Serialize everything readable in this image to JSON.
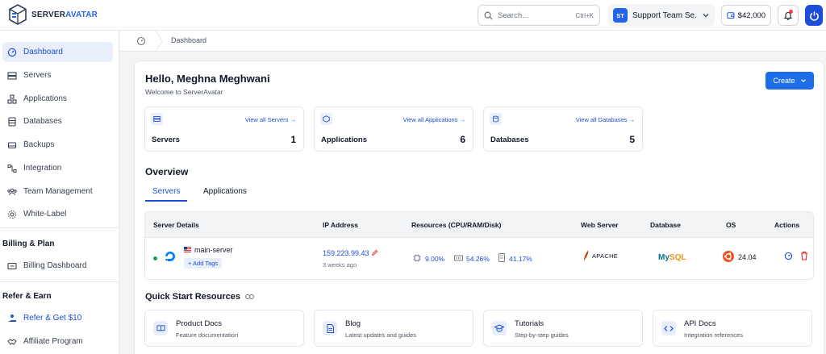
{
  "brand": {
    "name_dark": "SERVER",
    "name_accent": "AVATAR"
  },
  "topbar": {
    "search_placeholder": "Search...",
    "search_shortcut": "Ctrl+K",
    "team_initials": "ST",
    "team_name": "Support Team Se...",
    "credit": "$42,000"
  },
  "sidebar": {
    "items": [
      {
        "label": "Dashboard",
        "icon": "dashboard-icon"
      },
      {
        "label": "Servers",
        "icon": "server-icon"
      },
      {
        "label": "Applications",
        "icon": "applications-icon"
      },
      {
        "label": "Databases",
        "icon": "database-icon"
      },
      {
        "label": "Backups",
        "icon": "backup-icon"
      },
      {
        "label": "Integration",
        "icon": "integration-icon"
      },
      {
        "label": "Team Management",
        "icon": "team-icon"
      },
      {
        "label": "White-Label",
        "icon": "white-label-icon"
      }
    ],
    "billing_title": "Billing & Plan",
    "billing_item": "Billing Dashboard",
    "refer_title": "Refer & Earn",
    "refer_item": "Refer & Get $10",
    "affiliate_item": "Affiliate Program"
  },
  "breadcrumb": {
    "current": "Dashboard"
  },
  "main": {
    "greeting": "Hello, Meghna Meghwani",
    "welcome": "Welcome to ServerAvatar",
    "create_label": "Create",
    "stats": [
      {
        "label": "Servers",
        "link": "View all Servers →",
        "value": "1"
      },
      {
        "label": "Applications",
        "link": "View all Applications →",
        "value": "6"
      },
      {
        "label": "Databases",
        "link": "View all Databases →",
        "value": "5"
      }
    ],
    "overview_title": "Overview",
    "tabs": [
      "Servers",
      "Applications"
    ],
    "table": {
      "headers": [
        "Server Details",
        "IP Address",
        "Resources (CPU/RAM/Disk)",
        "Web Server",
        "Database",
        "OS",
        "Actions"
      ],
      "row": {
        "name": "main-server",
        "add_tags": "+ Add Tags",
        "ip": "159.223.99.43",
        "ip_age": "3 weeks ago",
        "cpu": "9.00%",
        "ram": "54.26%",
        "disk": "41.17%",
        "web_server": "APACHE",
        "database_my": "My",
        "database_sql": "SQL",
        "os_version": "24.04"
      }
    },
    "quick_start_title": "Quick Start Resources",
    "resources": [
      {
        "title": "Product Docs",
        "desc": "Feature documentation"
      },
      {
        "title": "Blog",
        "desc": "Latest updates and guides"
      },
      {
        "title": "Tutorials",
        "desc": "Step-by-step guides"
      },
      {
        "title": "API Docs",
        "desc": "Integration references"
      }
    ]
  },
  "colors": {
    "accent": "#1d6ee8",
    "active_bg": "#e8effb",
    "online": "#16a34a",
    "danger": "#dc2626"
  }
}
